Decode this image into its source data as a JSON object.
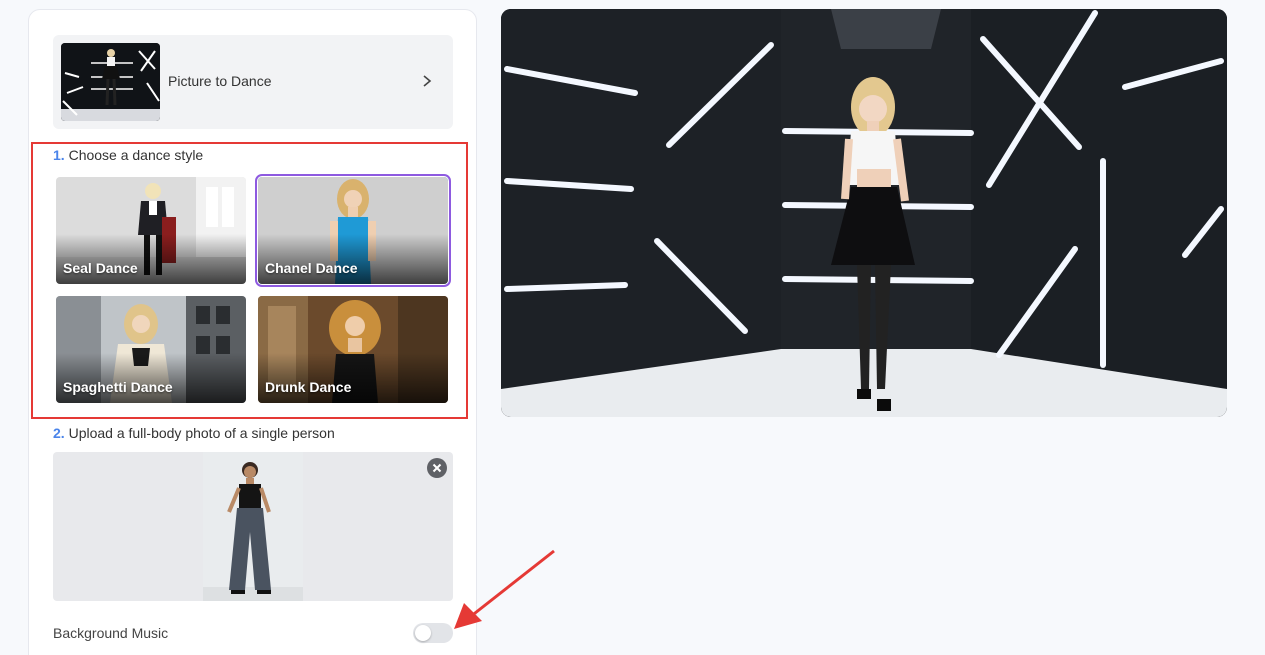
{
  "tool": {
    "label": "Picture to Dance"
  },
  "step1": {
    "num": "1.",
    "title": "Choose a dance style"
  },
  "styles": [
    {
      "label": "Seal Dance",
      "selected": false
    },
    {
      "label": "Chanel Dance",
      "selected": true
    },
    {
      "label": "Spaghetti Dance",
      "selected": false
    },
    {
      "label": "Drunk Dance",
      "selected": false
    }
  ],
  "step2": {
    "num": "2.",
    "title": "Upload a full-body photo of a single person"
  },
  "music": {
    "label": "Background Music",
    "enabled": false
  },
  "colors": {
    "accent": "#4a84ea",
    "highlight": "#e53935",
    "selected_border": "#8e5ae0"
  }
}
